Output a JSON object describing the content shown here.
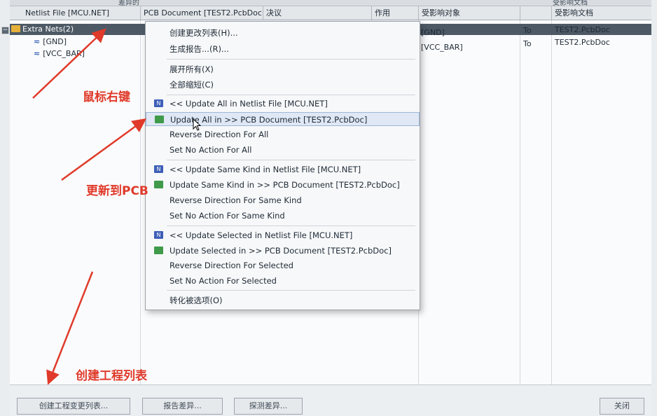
{
  "header": {
    "top_labels": [
      "差异的",
      "受影响文档"
    ],
    "columns": [
      "Netlist File [MCU.NET]",
      "PCB Document [TEST2.PcbDoc]",
      "决议",
      "作用",
      "受影响对象",
      "",
      "受影响文档"
    ]
  },
  "tree": {
    "root": "Extra Nets(2)",
    "children": [
      {
        "label": "[GND]",
        "object": "[GND]",
        "dir": "To",
        "doc": "TEST2.PcbDoc"
      },
      {
        "label": "[VCC_BAR]",
        "object": "[VCC_BAR]",
        "dir": "To",
        "doc": "TEST2.PcbDoc"
      }
    ]
  },
  "menu": {
    "items": [
      {
        "label": "创建更改列表(H)...",
        "icon": ""
      },
      {
        "label": "生成报告...(R)...",
        "icon": ""
      },
      {
        "label": "展开所有(X)",
        "icon": ""
      },
      {
        "label": "全部缩短(C)",
        "icon": ""
      },
      {
        "label": "<< Update All in Netlist File [MCU.NET]",
        "icon": "netlist-icon"
      },
      {
        "label": "Update All in >> PCB Document [TEST2.PcbDoc]",
        "icon": "pcb-icon"
      },
      {
        "label": "Reverse Direction For All",
        "icon": ""
      },
      {
        "label": "Set No Action For All",
        "icon": ""
      },
      {
        "label": "<< Update Same Kind in Netlist File [MCU.NET]",
        "icon": "netlist-icon"
      },
      {
        "label": "Update Same Kind in >> PCB Document [TEST2.PcbDoc]",
        "icon": "pcb-icon"
      },
      {
        "label": "Reverse Direction For Same Kind",
        "icon": ""
      },
      {
        "label": "Set No Action For Same Kind",
        "icon": ""
      },
      {
        "label": "<< Update Selected in Netlist File [MCU.NET]",
        "icon": "netlist-icon"
      },
      {
        "label": "Update Selected in >> PCB Document [TEST2.PcbDoc]",
        "icon": "pcb-icon"
      },
      {
        "label": "Reverse Direction For Selected",
        "icon": ""
      },
      {
        "label": "Set No Action For Selected",
        "icon": ""
      },
      {
        "label": "转化被选项(O)",
        "icon": ""
      }
    ]
  },
  "annotations": {
    "right_click": "鼠标右键",
    "update_pcb": "更新到PCB",
    "create_list": "创建工程列表"
  },
  "footer": {
    "buttons": [
      "创建工程变更列表...",
      "报告差异...",
      "探测差异...",
      "关闭"
    ]
  },
  "colors": {
    "annotation": "#e03a2a",
    "selected_row": "#4d5a66",
    "folder": "#e6b13a"
  }
}
